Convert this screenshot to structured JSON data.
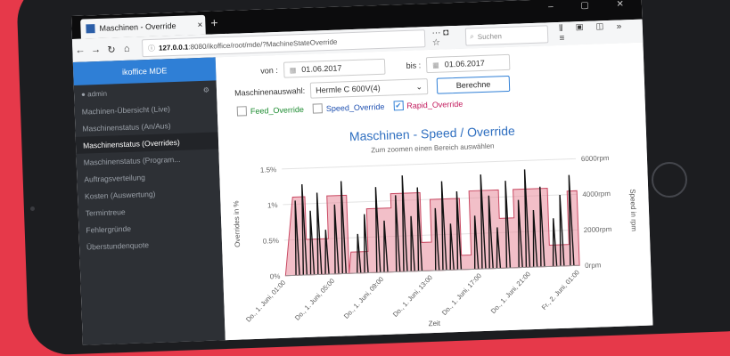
{
  "browser": {
    "tab_title": "Maschinen - Override",
    "tab_close": "×",
    "new_tab": "+",
    "url_host": "127.0.0.1",
    "url_path": ":8080/ikoffice/root/mde/?MachineStateOverride",
    "search_placeholder": "Suchen",
    "page_actions": "··· ◘ ☆",
    "toolbar_icons": "⫴ ▣ ◫ »  ≡",
    "window_controls": "– ▢ ✕"
  },
  "sidebar": {
    "brand": "ikoffice MDE",
    "user": "admin",
    "items": [
      {
        "label": "Machinen-Übersicht (Live)"
      },
      {
        "label": "Maschinenstatus (An/Aus)"
      },
      {
        "label": "Maschinenstatus (Overrides)",
        "active": true
      },
      {
        "label": "Maschinenstatus (Program..."
      },
      {
        "label": "Auftragsverteilung"
      },
      {
        "label": "Kosten (Auswertung)"
      },
      {
        "label": "Termintreue"
      },
      {
        "label": "Fehlergründe"
      },
      {
        "label": "Überstundenquote"
      }
    ]
  },
  "filters": {
    "from_label": "von :",
    "from_value": "01.06.2017",
    "to_label": "bis :",
    "to_value": "01.06.2017",
    "machine_label": "Maschinenauswahl:",
    "machine_value": "Hermle C 600V(4)",
    "calc_button": "Berechne",
    "feed_label": "Feed_Override",
    "feed_checked": false,
    "speed_label": "Speed_Override",
    "speed_checked": false,
    "rapid_label": "Rapid_Override",
    "rapid_checked": true,
    "check_mark": "✔"
  },
  "chart_data": {
    "type": "line",
    "title": "Maschinen - Speed / Override",
    "subtitle": "Zum zoomen einen Bereich auswählen",
    "xlabel": "Zeit",
    "ylabel_left": "Overrides in %",
    "ylabel_right": "Speed in rpm",
    "y_left_ticks": [
      "0%",
      "0.5%",
      "1%",
      "1.5%"
    ],
    "y_right_ticks": [
      "0rpm",
      "2000rpm",
      "4000rpm",
      "6000rpm"
    ],
    "x_ticks": [
      "Do., 1. Juni, 01:00",
      "Do., 1. Juni, 05:00",
      "Do., 1. Juni, 09:00",
      "Do., 1. Juni, 13:00",
      "Do., 1. Juni, 17:00",
      "Do., 1. Juni, 21:00",
      "Fr., 2. Juni, 01:00"
    ],
    "grid": true,
    "override_color": "#e88a9a",
    "speed_color": "#111111",
    "override_series": [
      [
        0.0,
        0.0
      ],
      [
        0.2,
        1.1
      ],
      [
        0.45,
        1.1
      ],
      [
        0.45,
        0.5
      ],
      [
        0.9,
        0.5
      ],
      [
        0.9,
        1.1
      ],
      [
        1.3,
        1.1
      ],
      [
        1.3,
        0.0
      ],
      [
        1.35,
        0.3
      ],
      [
        1.7,
        0.3
      ],
      [
        1.7,
        0.9
      ],
      [
        2.2,
        0.9
      ],
      [
        2.2,
        1.1
      ],
      [
        2.8,
        1.1
      ],
      [
        2.8,
        0.4
      ],
      [
        3.0,
        0.4
      ],
      [
        3.0,
        1.0
      ],
      [
        3.6,
        1.0
      ],
      [
        3.6,
        0.2
      ],
      [
        3.8,
        0.2
      ],
      [
        3.8,
        1.1
      ],
      [
        4.4,
        1.1
      ],
      [
        4.4,
        0.7
      ],
      [
        4.7,
        0.7
      ],
      [
        4.7,
        1.1
      ],
      [
        5.4,
        1.1
      ],
      [
        5.4,
        0.3
      ],
      [
        5.8,
        0.3
      ],
      [
        5.8,
        1.05
      ],
      [
        6.0,
        1.05
      ]
    ],
    "speed_spikes": [
      [
        0.25,
        4200
      ],
      [
        0.4,
        5100
      ],
      [
        0.55,
        3600
      ],
      [
        0.7,
        4600
      ],
      [
        0.85,
        2500
      ],
      [
        1.05,
        3900
      ],
      [
        1.2,
        5200
      ],
      [
        1.5,
        2200
      ],
      [
        1.65,
        3300
      ],
      [
        1.9,
        4800
      ],
      [
        2.05,
        2900
      ],
      [
        2.3,
        4300
      ],
      [
        2.45,
        5400
      ],
      [
        2.6,
        3100
      ],
      [
        2.75,
        4700
      ],
      [
        3.1,
        3500
      ],
      [
        3.25,
        5000
      ],
      [
        3.4,
        2600
      ],
      [
        3.55,
        4400
      ],
      [
        3.9,
        3000
      ],
      [
        4.05,
        5300
      ],
      [
        4.2,
        4100
      ],
      [
        4.35,
        2300
      ],
      [
        4.55,
        4900
      ],
      [
        4.8,
        3800
      ],
      [
        4.95,
        5500
      ],
      [
        5.1,
        3200
      ],
      [
        5.25,
        4500
      ],
      [
        5.5,
        2700
      ],
      [
        5.65,
        4000
      ],
      [
        5.85,
        5100
      ]
    ]
  }
}
